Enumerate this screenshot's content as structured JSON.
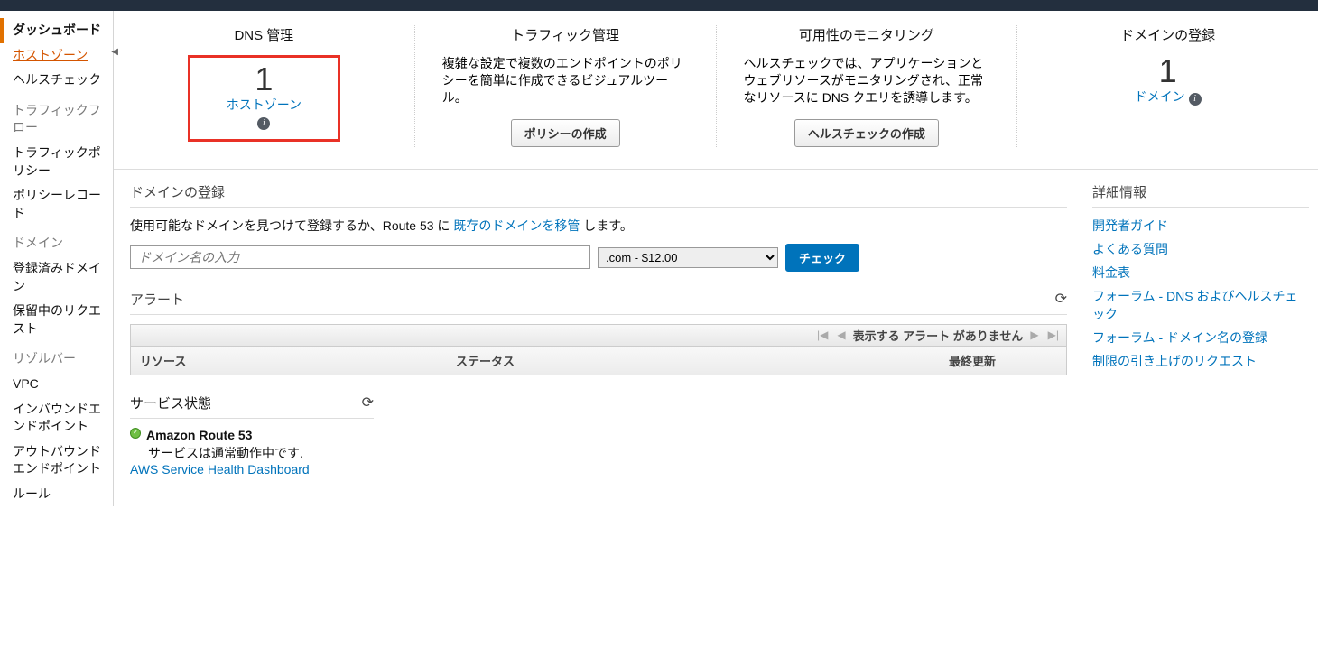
{
  "sidebar": {
    "items": [
      {
        "label": "ダッシュボード",
        "kind": "item",
        "sel": true
      },
      {
        "label": "ホストゾーン",
        "kind": "item",
        "active": true
      },
      {
        "label": "ヘルスチェック",
        "kind": "item"
      },
      {
        "label": "トラフィックフロー",
        "kind": "header"
      },
      {
        "label": "トラフィックポリシー",
        "kind": "item"
      },
      {
        "label": "ポリシーレコード",
        "kind": "item"
      },
      {
        "label": "ドメイン",
        "kind": "header"
      },
      {
        "label": "登録済みドメイン",
        "kind": "item"
      },
      {
        "label": "保留中のリクエスト",
        "kind": "item"
      },
      {
        "label": "リゾルバー",
        "kind": "header"
      },
      {
        "label": "VPC",
        "kind": "item"
      },
      {
        "label": "インバウンドエンドポイント",
        "kind": "item"
      },
      {
        "label": "アウトバウンドエンドポイント",
        "kind": "item"
      },
      {
        "label": "ルール",
        "kind": "item"
      }
    ]
  },
  "cards": {
    "dns": {
      "title": "DNS 管理",
      "count": "1",
      "link": "ホストゾーン"
    },
    "traffic": {
      "title": "トラフィック管理",
      "desc": "複雑な設定で複数のエンドポイントのポリシーを簡単に作成できるビジュアルツール。",
      "button": "ポリシーの作成"
    },
    "avail": {
      "title": "可用性のモニタリング",
      "desc": "ヘルスチェックでは、アプリケーションとウェブリソースがモニタリングされ、正常なリソースに DNS クエリを誘導します。",
      "button": "ヘルスチェックの作成"
    },
    "domain": {
      "title": "ドメインの登録",
      "count": "1",
      "link": "ドメイン"
    }
  },
  "register": {
    "heading": "ドメインの登録",
    "pre": "使用可能なドメインを見つけて登録するか、Route 53 に ",
    "link": "既存のドメインを移管",
    "post": " します。",
    "placeholder": "ドメイン名の入力",
    "tld": ".com - $12.00",
    "check": "チェック"
  },
  "alerts": {
    "heading": "アラート",
    "empty": "表示する アラート がありません",
    "cols": {
      "a": "リソース",
      "b": "ステータス",
      "c": "最終更新"
    }
  },
  "service": {
    "heading": "サービス状態",
    "name": "Amazon Route 53",
    "status": "サービスは通常動作中です.",
    "dash": "AWS Service Health Dashboard"
  },
  "info": {
    "heading": "詳細情報",
    "links": [
      "開発者ガイド",
      "よくある質問",
      "料金表",
      "フォーラム - DNS およびヘルスチェック",
      "フォーラム - ドメイン名の登録",
      "制限の引き上げのリクエスト"
    ]
  }
}
